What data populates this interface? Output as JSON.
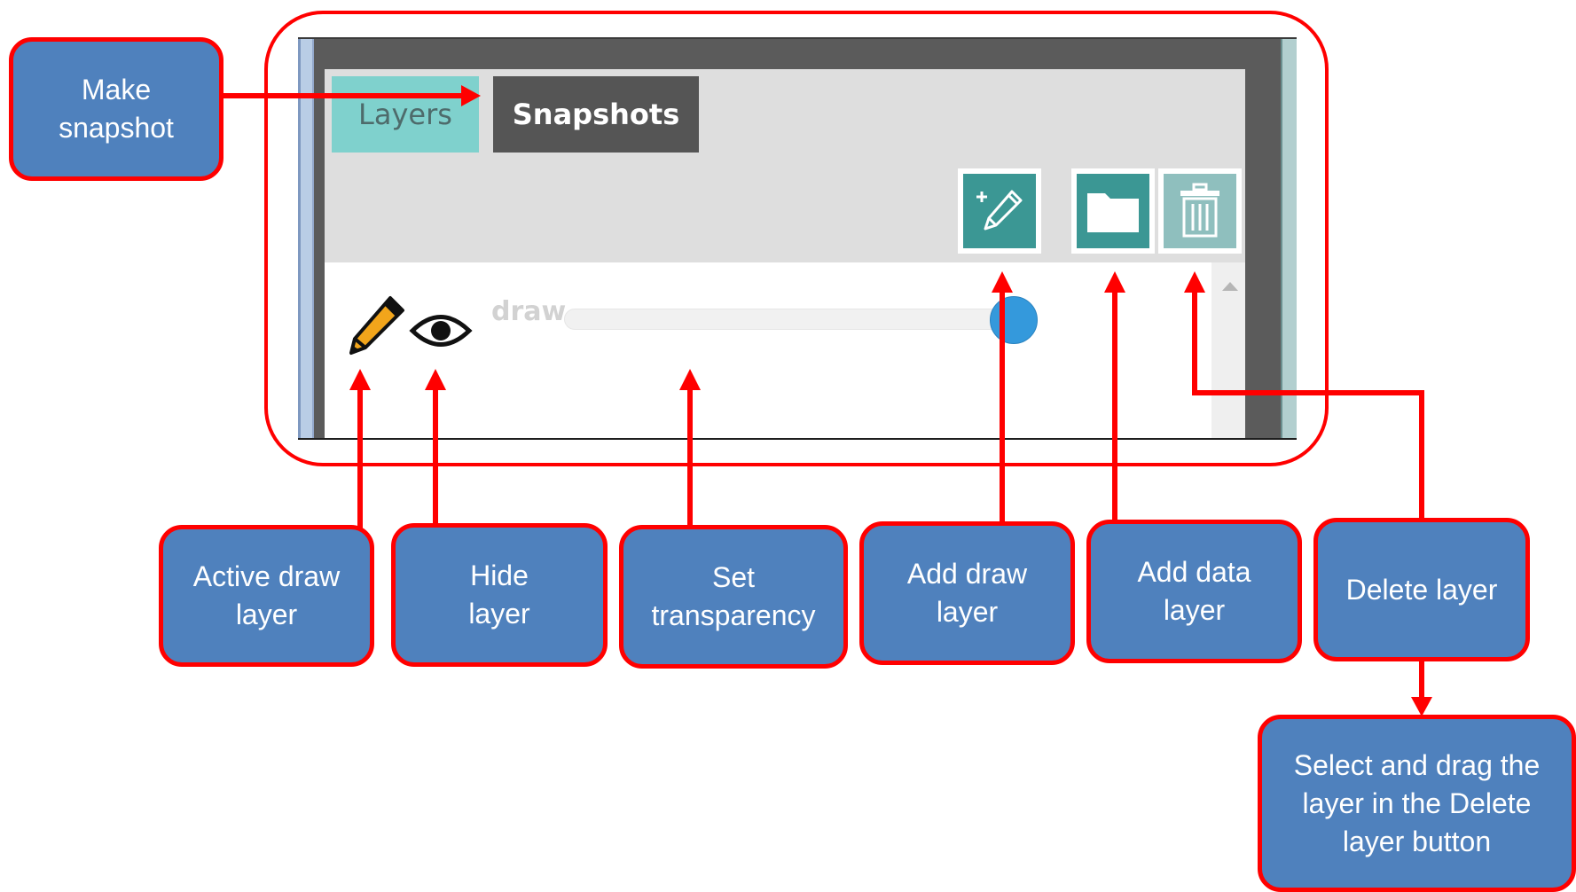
{
  "panel": {
    "tabs": [
      {
        "label": "Layers",
        "active": true
      },
      {
        "label": "Snapshots",
        "active": false
      }
    ],
    "toolbar": {
      "add_draw_layer_icon": "pencil-plus-icon",
      "add_data_layer_icon": "folder-icon",
      "delete_layer_icon": "trash-icon"
    },
    "layers": [
      {
        "name": "draw",
        "active": true,
        "visible": true
      }
    ]
  },
  "annotations": {
    "make_snapshot": "Make\nsnapshot",
    "active_draw_layer": "Active draw\nlayer",
    "hide_layer": "Hide\nlayer",
    "set_transparency": "Set\ntransparency",
    "add_draw_layer": "Add draw\nlayer",
    "add_data_layer": "Add data\nlayer",
    "delete_layer": "Delete layer",
    "drag_to_delete": "Select and drag the\nlayer in the Delete\nlayer button"
  },
  "colors": {
    "callout_fill": "#4f81bd",
    "annotation_red": "#ff0000",
    "tab_active": "#7fd1cd",
    "tool_button": "#3b9794",
    "slider_thumb": "#3499dc"
  }
}
